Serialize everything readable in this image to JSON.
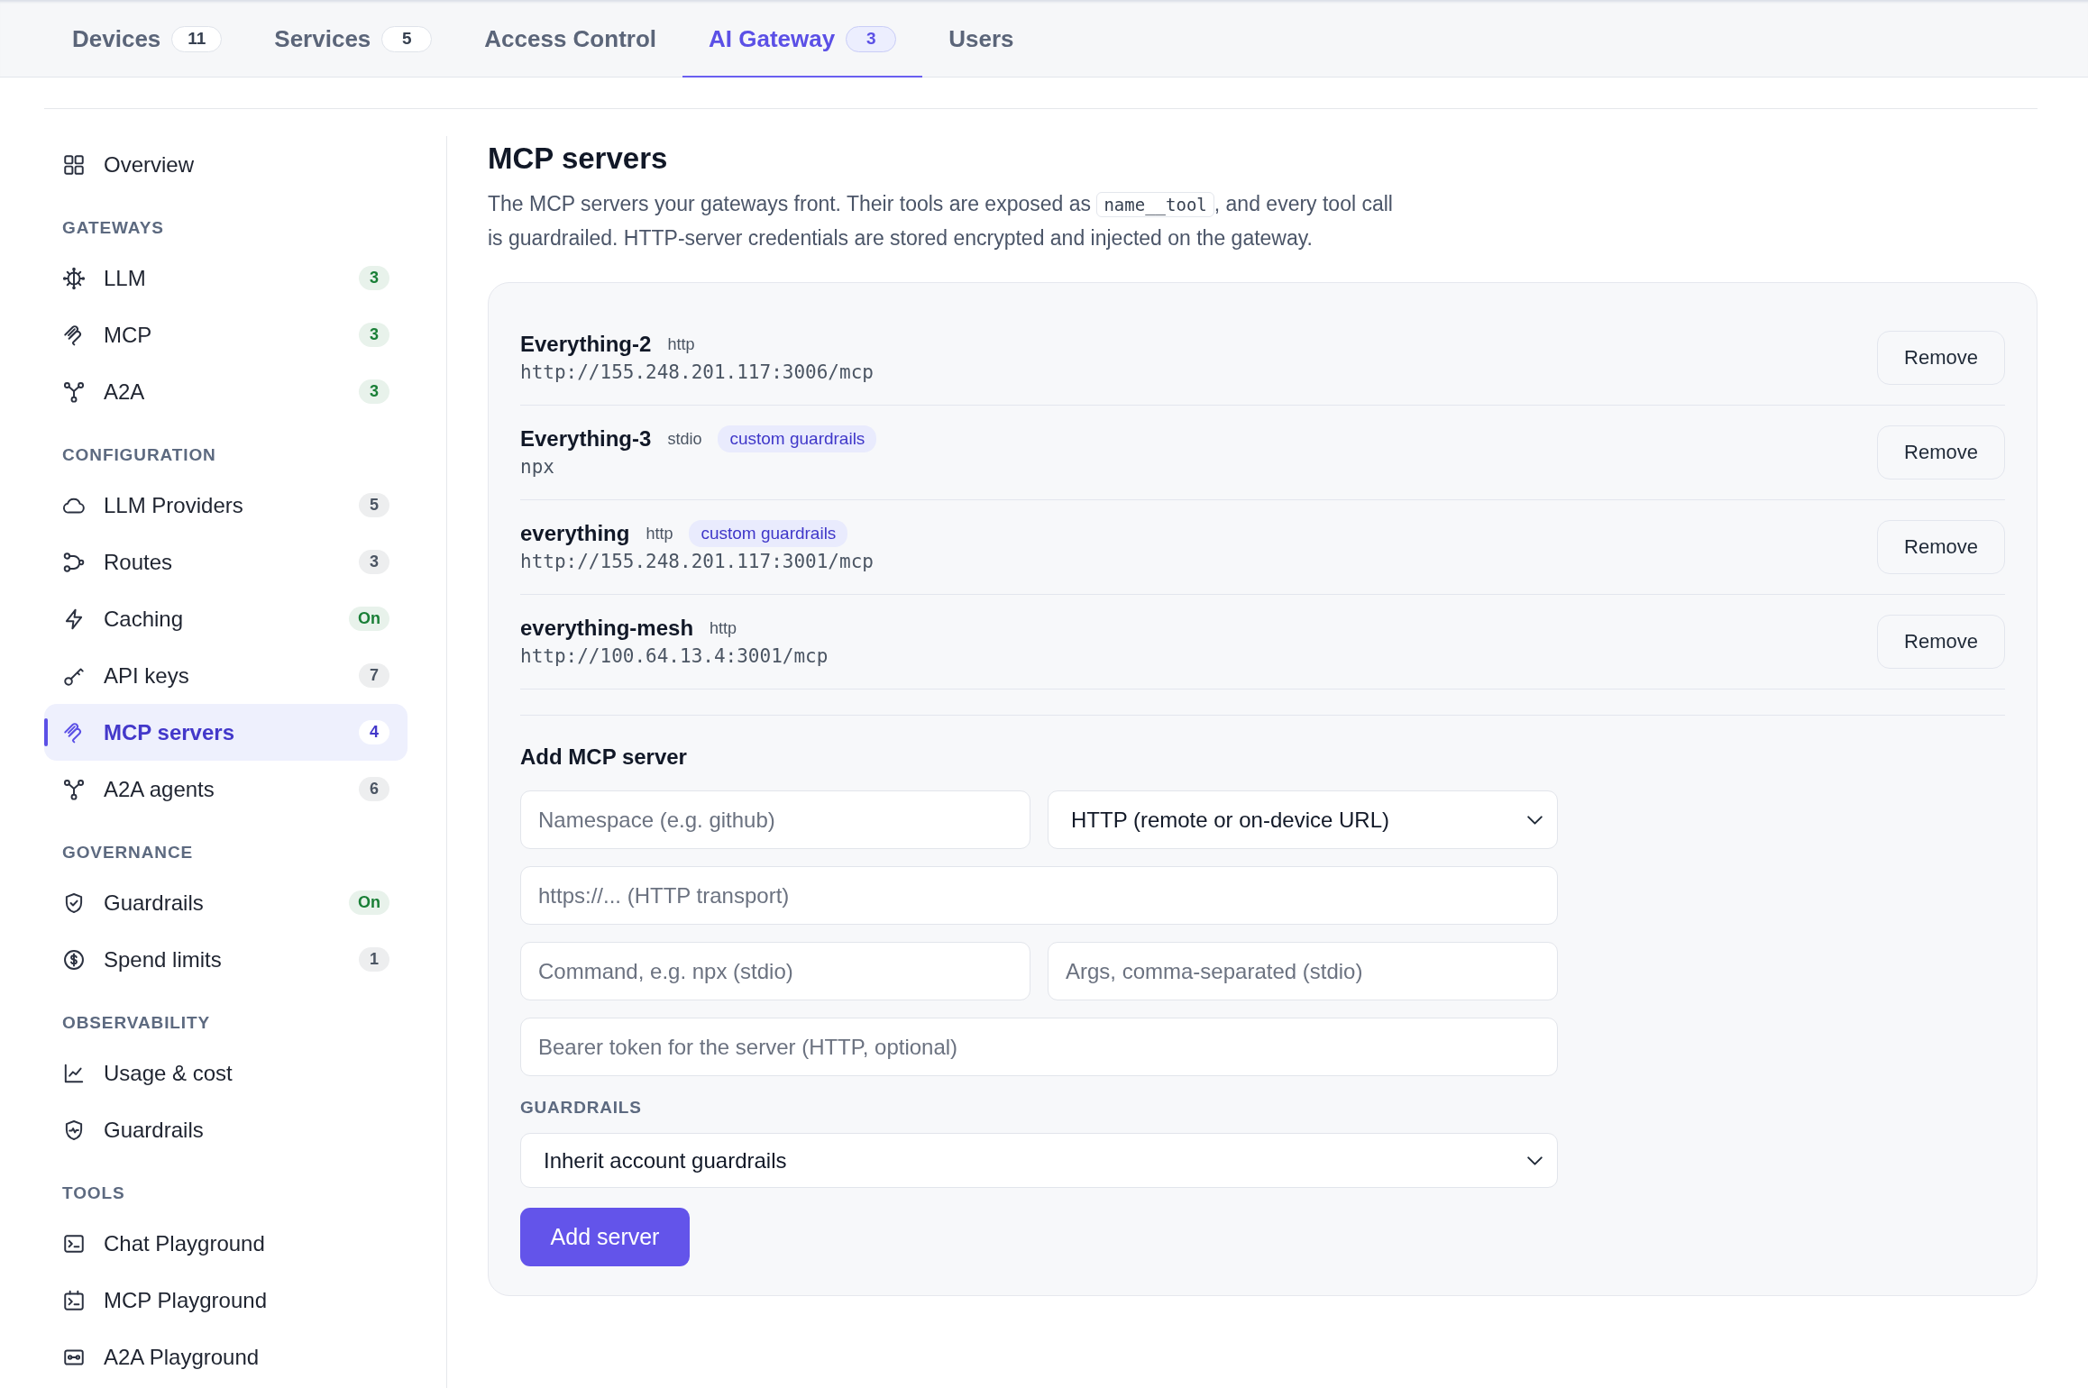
{
  "tabs": [
    {
      "label": "Devices",
      "count": "11",
      "selected": false
    },
    {
      "label": "Services",
      "count": "5",
      "selected": false
    },
    {
      "label": "Access Control",
      "selected": false
    },
    {
      "label": "AI Gateway",
      "count": "3",
      "selected": true
    },
    {
      "label": "Users",
      "selected": false
    }
  ],
  "sidebar": {
    "sections": [
      {
        "items": [
          {
            "label": "Overview",
            "selected": false
          }
        ]
      },
      {
        "title": "GATEWAYS",
        "items": [
          {
            "label": "LLM",
            "badge": {
              "text": "3",
              "color": "#1a7f37"
            },
            "selected": false
          },
          {
            "label": "MCP",
            "badge": {
              "text": "3",
              "color": "#1a7f37"
            },
            "selected": false
          },
          {
            "label": "A2A",
            "badge": {
              "text": "3",
              "color": "#1a7f37"
            },
            "selected": false
          }
        ]
      },
      {
        "title": "CONFIGURATION",
        "items": [
          {
            "label": "LLM Providers",
            "badge": {
              "text": "5",
              "color": "#4b5563"
            },
            "selected": false
          },
          {
            "label": "Routes",
            "badge": {
              "text": "3",
              "color": "#4b5563"
            },
            "selected": false
          },
          {
            "label": "Caching",
            "badge": {
              "text": "On",
              "color": "#1a7f37"
            },
            "selected": false
          },
          {
            "label": "API keys",
            "badge": {
              "text": "7",
              "color": "#4b5563"
            },
            "selected": false
          },
          {
            "label": "MCP servers",
            "badge": {
              "text": "4",
              "color": "#4338ca"
            },
            "selected": true
          },
          {
            "label": "A2A agents",
            "badge": {
              "text": "6",
              "color": "#4b5563"
            },
            "selected": false
          }
        ]
      },
      {
        "title": "GOVERNANCE",
        "items": [
          {
            "label": "Guardrails",
            "badge": {
              "text": "On",
              "color": "#1a7f37"
            },
            "selected": false
          },
          {
            "label": "Spend limits",
            "badge": {
              "text": "1",
              "color": "#4b5563"
            },
            "selected": false
          }
        ]
      },
      {
        "title": "OBSERVABILITY",
        "items": [
          {
            "label": "Usage & cost",
            "selected": false
          },
          {
            "label": "Guardrails",
            "selected": false
          }
        ]
      },
      {
        "title": "TOOLS",
        "items": [
          {
            "label": "Chat Playground",
            "selected": false
          },
          {
            "label": "MCP Playground",
            "selected": false
          },
          {
            "label": "A2A Playground",
            "selected": false
          }
        ]
      }
    ]
  },
  "page": {
    "title": "MCP servers",
    "description": [
      {
        "kind": "text",
        "text": "The MCP servers your gateways front. Their tools are exposed as "
      },
      {
        "kind": "code",
        "text": "name__tool"
      },
      {
        "kind": "text",
        "text": ", and every tool call is guardrailed. HTTP-server credentials are stored encrypted and injected on the gateway."
      }
    ]
  },
  "servers": [
    {
      "name": "Everything-2",
      "transport": "http",
      "address": "http://155.248.201.117:3006/mcp",
      "action": "Remove"
    },
    {
      "name": "Everything-3",
      "transport": "stdio",
      "tags": [
        "custom guardrails"
      ],
      "address": "npx",
      "action": "Remove"
    },
    {
      "name": "everything",
      "transport": "http",
      "tags": [
        "custom guardrails"
      ],
      "address": "http://155.248.201.117:3001/mcp",
      "action": "Remove"
    },
    {
      "name": "everything-mesh",
      "transport": "http",
      "address": "http://100.64.13.4:3001/mcp",
      "action": "Remove"
    }
  ],
  "add_server": {
    "title": "Add MCP server",
    "rows": [
      [
        {
          "kind": "input",
          "placeholder": "Namespace (e.g. github)"
        },
        {
          "kind": "select",
          "value": "HTTP (remote or on-device URL)"
        }
      ],
      [
        {
          "kind": "input",
          "placeholder": "https://... (HTTP transport)"
        }
      ],
      [
        {
          "kind": "input",
          "placeholder": "Command, e.g. npx (stdio)"
        },
        {
          "kind": "input",
          "placeholder": "Args, comma-separated (stdio)"
        }
      ],
      [
        {
          "kind": "input",
          "placeholder": "Bearer token for the server (HTTP, optional)"
        }
      ]
    ],
    "guardrails": {
      "label": "GUARDRAILS",
      "value": "Inherit account guardrails"
    },
    "submit": "Add server"
  }
}
